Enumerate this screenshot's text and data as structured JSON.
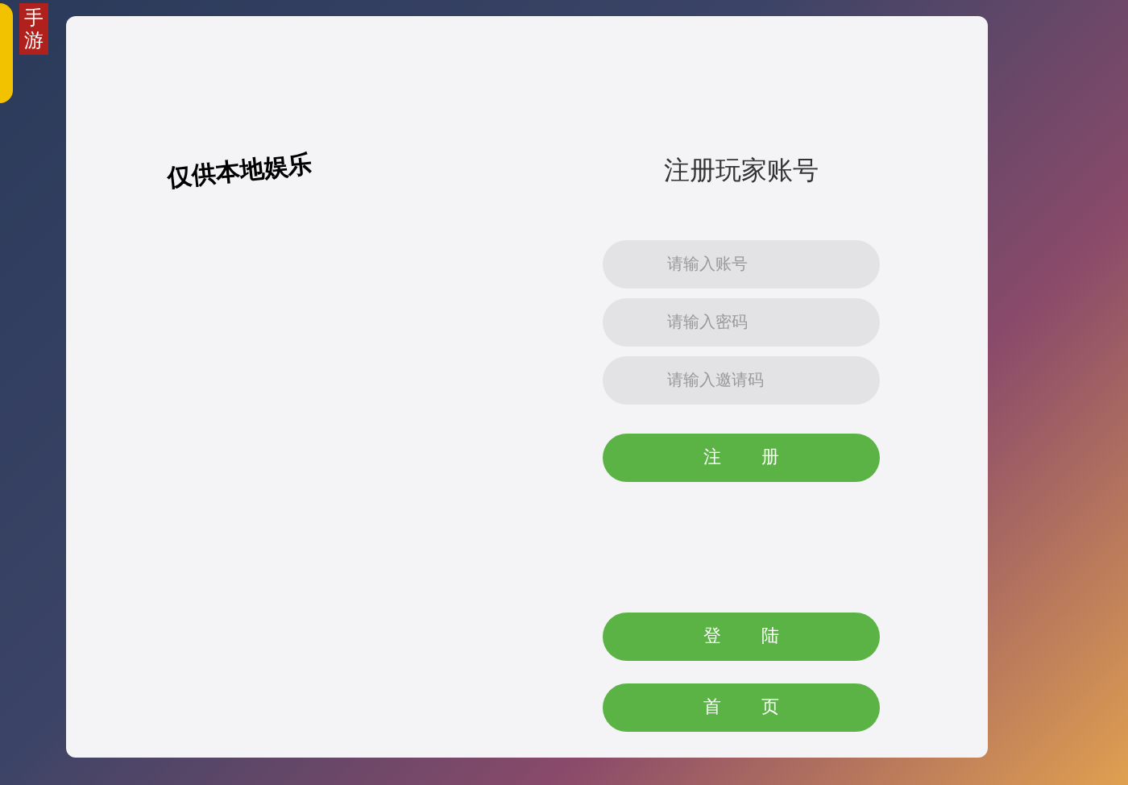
{
  "logo": {
    "text": "手游"
  },
  "notice": "仅供本地娱乐",
  "form": {
    "title": "注册玩家账号",
    "fields": [
      {
        "placeholder": "请输入账号"
      },
      {
        "placeholder": "请输入密码"
      },
      {
        "placeholder": "请输入邀请码"
      }
    ],
    "register_button": "注 册"
  },
  "buttons": [
    {
      "label": "登 陆"
    },
    {
      "label": "首 页"
    }
  ]
}
